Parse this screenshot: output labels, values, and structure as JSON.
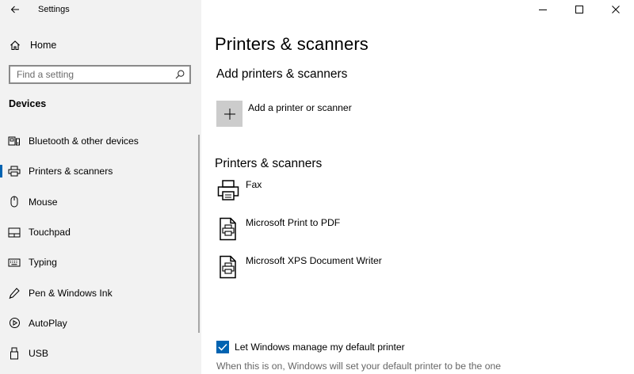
{
  "window": {
    "app_title": "Settings"
  },
  "sidebar": {
    "home_label": "Home",
    "search_placeholder": "Find a setting",
    "section_title": "Devices",
    "items": [
      {
        "label": "Bluetooth & other devices",
        "icon": "bluetooth-devices-icon",
        "active": false
      },
      {
        "label": "Printers & scanners",
        "icon": "printer-icon",
        "active": true
      },
      {
        "label": "Mouse",
        "icon": "mouse-icon",
        "active": false
      },
      {
        "label": "Touchpad",
        "icon": "touchpad-icon",
        "active": false
      },
      {
        "label": "Typing",
        "icon": "keyboard-icon",
        "active": false
      },
      {
        "label": "Pen & Windows Ink",
        "icon": "pen-icon",
        "active": false
      },
      {
        "label": "AutoPlay",
        "icon": "autoplay-icon",
        "active": false
      },
      {
        "label": "USB",
        "icon": "usb-icon",
        "active": false
      }
    ]
  },
  "main": {
    "page_title": "Printers & scanners",
    "add_section_title": "Add printers & scanners",
    "add_button_label": "Add a printer or scanner",
    "list_section_title": "Printers & scanners",
    "printers": [
      {
        "name": "Fax",
        "icon": "fax-printer-icon"
      },
      {
        "name": "Microsoft Print to PDF",
        "icon": "document-printer-icon"
      },
      {
        "name": "Microsoft XPS Document Writer",
        "icon": "document-printer-icon"
      }
    ],
    "default_printer_checkbox": {
      "label": "Let Windows manage my default printer",
      "checked": true
    },
    "hint_text": "When this is on, Windows will set your default printer to be the one"
  },
  "colors": {
    "accent": "#0063b1",
    "sidebar_bg": "#f2f2f2",
    "add_tile_bg": "#cccccc"
  }
}
